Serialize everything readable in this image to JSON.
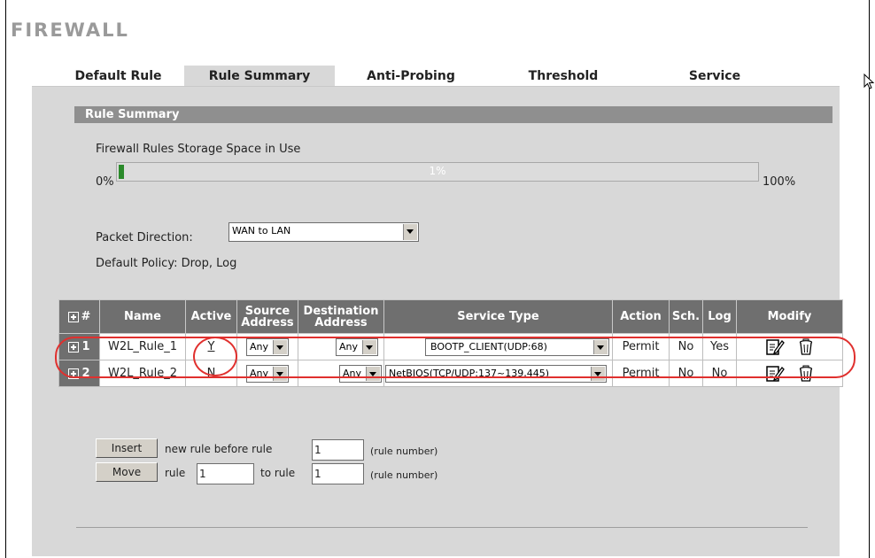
{
  "page": {
    "title": "FIREWALL"
  },
  "tabs": [
    {
      "label": "Default Rule",
      "active": false
    },
    {
      "label": "Rule Summary",
      "active": true
    },
    {
      "label": "Anti-Probing",
      "active": false
    },
    {
      "label": "Threshold",
      "active": false
    },
    {
      "label": "Service",
      "active": false
    }
  ],
  "section": {
    "title": "Rule Summary"
  },
  "storage": {
    "label": "Firewall Rules Storage Space in Use",
    "min_label": "0%",
    "max_label": "100%",
    "value_text": "1%",
    "value": 0.01
  },
  "packet_direction": {
    "label": "Packet Direction:",
    "value": "WAN to LAN"
  },
  "default_policy": {
    "text": "Default Policy: Drop, Log"
  },
  "table": {
    "headers": {
      "num": "#",
      "name": "Name",
      "active": "Active",
      "source": "Source Address",
      "destination": "Destination Address",
      "service": "Service Type",
      "action": "Action",
      "sch": "Sch.",
      "log": "Log",
      "modify": "Modify"
    },
    "rows": [
      {
        "num": "1",
        "name": "W2L_Rule_1",
        "active": "Y",
        "source": "Any",
        "destination": "Any",
        "service": "BOOTP_CLIENT(UDP:68)",
        "action": "Permit",
        "sch": "No",
        "log": "Yes"
      },
      {
        "num": "2",
        "name": "W2L_Rule_2",
        "active": "N",
        "source": "Any",
        "destination": "Any",
        "service": "NetBIOS(TCP/UDP:137~139,445)",
        "action": "Permit",
        "sch": "No",
        "log": "No"
      }
    ]
  },
  "insert": {
    "button": "Insert",
    "text": "new rule before rule",
    "value": "1",
    "hint": "(rule number)"
  },
  "move": {
    "button": "Move",
    "text_rule": "rule",
    "from_value": "1",
    "text_to": "to rule",
    "to_value": "1",
    "hint": "(rule number)"
  },
  "colors": {
    "highlight": "#e0302e",
    "progress": "#2a8a2a",
    "header": "#6f6f6f",
    "panel": "#d8d8d8"
  }
}
